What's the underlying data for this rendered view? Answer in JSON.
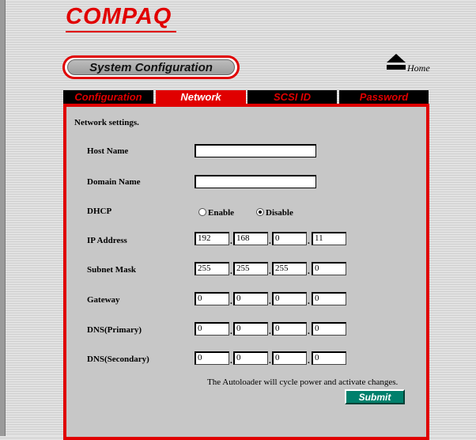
{
  "brand": {
    "logo_text": "COMPAQ",
    "accent_color": "#e00000"
  },
  "header": {
    "section_title": "System Configuration",
    "home_label": "Home",
    "home_icon": "eject-icon"
  },
  "tabs": [
    {
      "label": "Configuration",
      "active": false
    },
    {
      "label": "Network",
      "active": true
    },
    {
      "label": "SCSI ID",
      "active": false
    },
    {
      "label": "Password",
      "active": false
    }
  ],
  "network": {
    "heading": "Network settings.",
    "host_name": {
      "label": "Host Name",
      "value": ""
    },
    "domain_name": {
      "label": "Domain Name",
      "value": ""
    },
    "dhcp": {
      "label": "DHCP",
      "options": [
        "Enable",
        "Disable"
      ],
      "selected": "Disable"
    },
    "ip_address": {
      "label": "IP Address",
      "octets": [
        "192",
        "168",
        "0",
        "11"
      ]
    },
    "subnet_mask": {
      "label": "Subnet Mask",
      "octets": [
        "255",
        "255",
        "255",
        "0"
      ]
    },
    "gateway": {
      "label": "Gateway",
      "octets": [
        "0",
        "0",
        "0",
        "0"
      ]
    },
    "dns_primary": {
      "label": "DNS(Primary)",
      "octets": [
        "0",
        "0",
        "0",
        "0"
      ]
    },
    "dns_secondary": {
      "label": "DNS(Secondary)",
      "octets": [
        "0",
        "0",
        "0",
        "0"
      ]
    },
    "dot": ".",
    "note": "The Autoloader will cycle power and activate changes.",
    "submit_label": "Submit"
  }
}
